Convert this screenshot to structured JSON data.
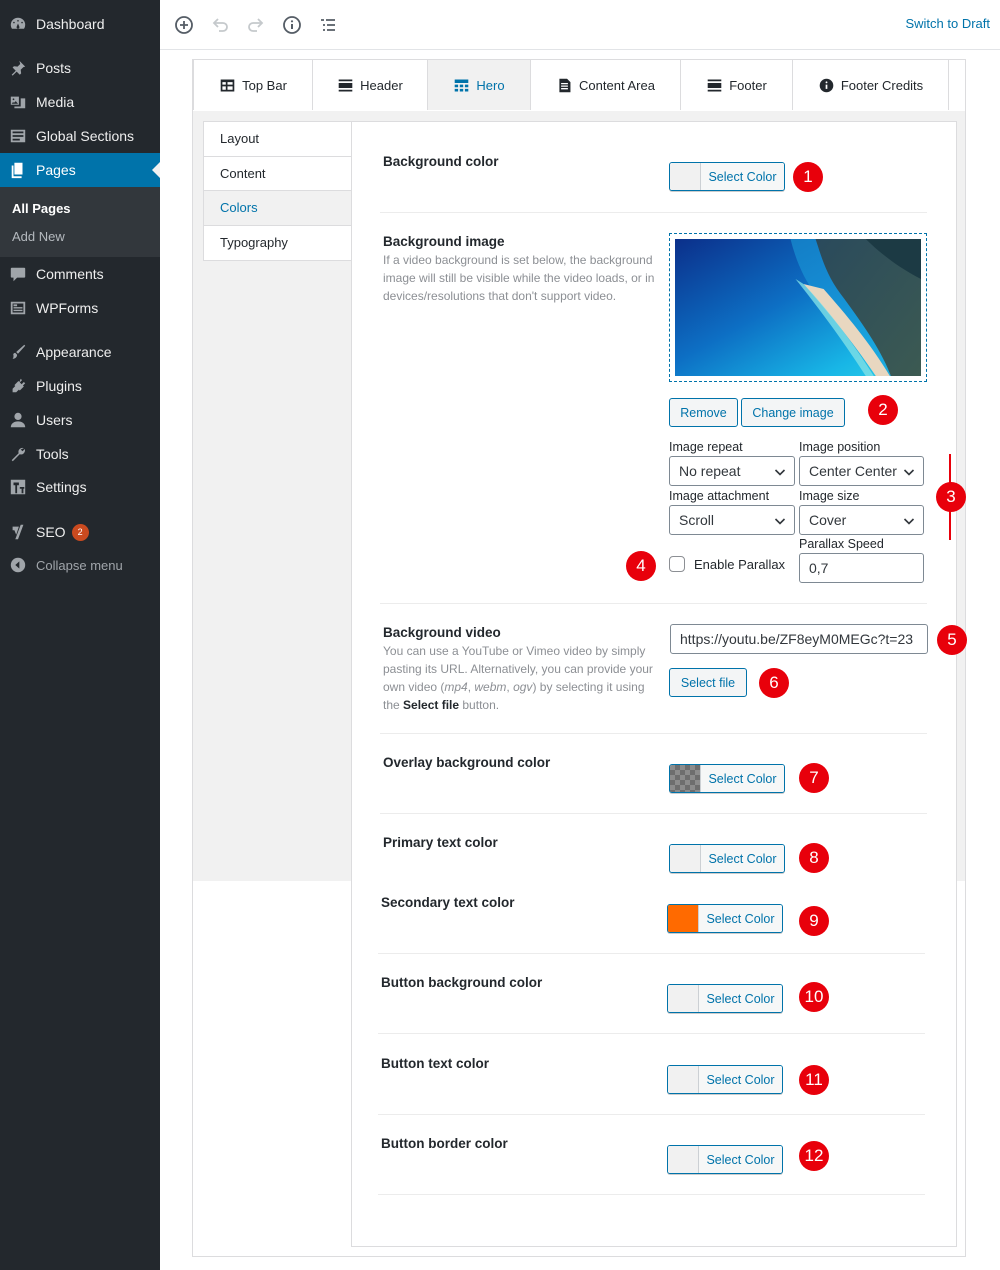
{
  "sidebar": {
    "items": [
      {
        "label": "Dashboard",
        "icon": "dashboard-icon"
      },
      {
        "label": "Posts",
        "icon": "pin-icon"
      },
      {
        "label": "Media",
        "icon": "media-icon"
      },
      {
        "label": "Global Sections",
        "icon": "sections-icon"
      },
      {
        "label": "Pages",
        "icon": "pages-icon"
      },
      {
        "label": "Comments",
        "icon": "comment-icon"
      },
      {
        "label": "WPForms",
        "icon": "forms-icon"
      },
      {
        "label": "Appearance",
        "icon": "brush-icon"
      },
      {
        "label": "Plugins",
        "icon": "plug-icon"
      },
      {
        "label": "Users",
        "icon": "user-icon"
      },
      {
        "label": "Tools",
        "icon": "wrench-icon"
      },
      {
        "label": "Settings",
        "icon": "settings-icon"
      },
      {
        "label": "SEO",
        "icon": "yoast-icon",
        "badge": "2"
      }
    ],
    "submenu": [
      "All Pages",
      "Add New"
    ],
    "collapse_label": "Collapse menu"
  },
  "toolbar": {
    "icons": [
      "add-block-icon",
      "undo-icon",
      "redo-icon",
      "info-icon",
      "outline-icon"
    ],
    "switch_draft": "Switch to Draft"
  },
  "tabs": [
    {
      "label": "Top Bar",
      "icon": "table-icon"
    },
    {
      "label": "Header",
      "icon": "header-icon"
    },
    {
      "label": "Hero",
      "icon": "hero-icon"
    },
    {
      "label": "Content Area",
      "icon": "document-icon"
    },
    {
      "label": "Footer",
      "icon": "footer-icon"
    },
    {
      "label": "Footer Credits",
      "icon": "info-icon"
    }
  ],
  "subtabs": [
    "Layout",
    "Content",
    "Colors",
    "Typography"
  ],
  "fields": {
    "background_color": {
      "title": "Background color",
      "button": "Select Color",
      "callout": "1"
    },
    "background_image": {
      "title": "Background image",
      "desc": "If a video background is set below, the background image will still be visible while the video loads, or in devices/resolutions that don't support video.",
      "remove": "Remove",
      "change": "Change image",
      "callout_buttons": "2",
      "callout_options": "3",
      "image_repeat_label": "Image repeat",
      "image_repeat_value": "No repeat",
      "image_position_label": "Image position",
      "image_position_value": "Center Center",
      "image_attachment_label": "Image attachment",
      "image_attachment_value": "Scroll",
      "image_size_label": "Image size",
      "image_size_value": "Cover",
      "parallax_callout": "4",
      "enable_parallax": "Enable Parallax",
      "parallax_speed_label": "Parallax Speed",
      "parallax_speed_value": "0,7"
    },
    "background_video": {
      "title": "Background video",
      "desc_1": "You can use a YouTube or Vimeo video by simply pasting its URL. Alternatively, you can provide your own video (",
      "desc_mp4": "mp4",
      "desc_sep1": ", ",
      "desc_webm": "webm",
      "desc_sep2": ", ",
      "desc_ogv": "ogv",
      "desc_2": ") by selecting it using the ",
      "desc_bold": "Select file",
      "desc_3": " button.",
      "url": "https://youtu.be/ZF8eyM0MEGc?t=23",
      "callout_url": "5",
      "select_file": "Select file",
      "callout_file": "6"
    },
    "overlay_color": {
      "title": "Overlay background color",
      "button": "Select Color",
      "callout": "7"
    },
    "primary_text": {
      "title": "Primary text color",
      "button": "Select Color",
      "callout": "8"
    },
    "secondary_text": {
      "title": "Secondary text color",
      "button": "Select Color",
      "callout": "9"
    },
    "button_bg": {
      "title": "Button background color",
      "button": "Select Color",
      "callout": "10"
    },
    "button_text": {
      "title": "Button text color",
      "button": "Select Color",
      "callout": "11"
    },
    "button_border": {
      "title": "Button border color",
      "button": "Select Color",
      "callout": "12"
    }
  },
  "colors": {
    "admin_bg": "#23282d",
    "accent": "#0073aa",
    "callout": "#e8000b",
    "secondary_swatch": "#ff6a00"
  }
}
